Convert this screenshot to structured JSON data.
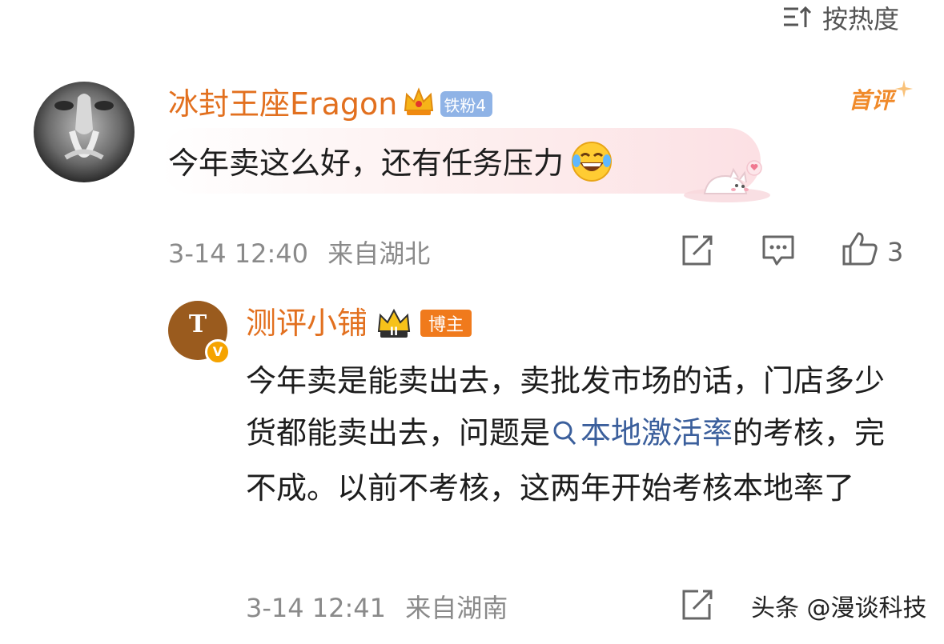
{
  "sort": {
    "label": "按热度"
  },
  "comment": {
    "username": "冰封王座Eragon",
    "fan_badge": "铁粉4",
    "first_tag": "首评",
    "text": "今年卖这么好，还有任务压力",
    "emoji": "laughing-tears",
    "time": "3-14 12:40",
    "location": "来自湖北",
    "like_count": "3"
  },
  "reply": {
    "username": "测评小铺",
    "role_badge": "博主",
    "level_badge": "II",
    "text_before": "今年卖是能卖出去，卖批发市场的话，门店多少货都能卖出去，问题是",
    "link_text": "本地激活率",
    "text_after": "的考核，完不成。以前不考核，这两年开始考核本地率了",
    "time": "3-14 12:41",
    "location": "来自湖南",
    "avatar_letter": "T",
    "verified_mark": "V"
  },
  "watermark": "头条 @漫谈科技",
  "colors": {
    "username": "#e2701f",
    "link": "#3b5f9c",
    "meta": "#8a8a8a"
  }
}
